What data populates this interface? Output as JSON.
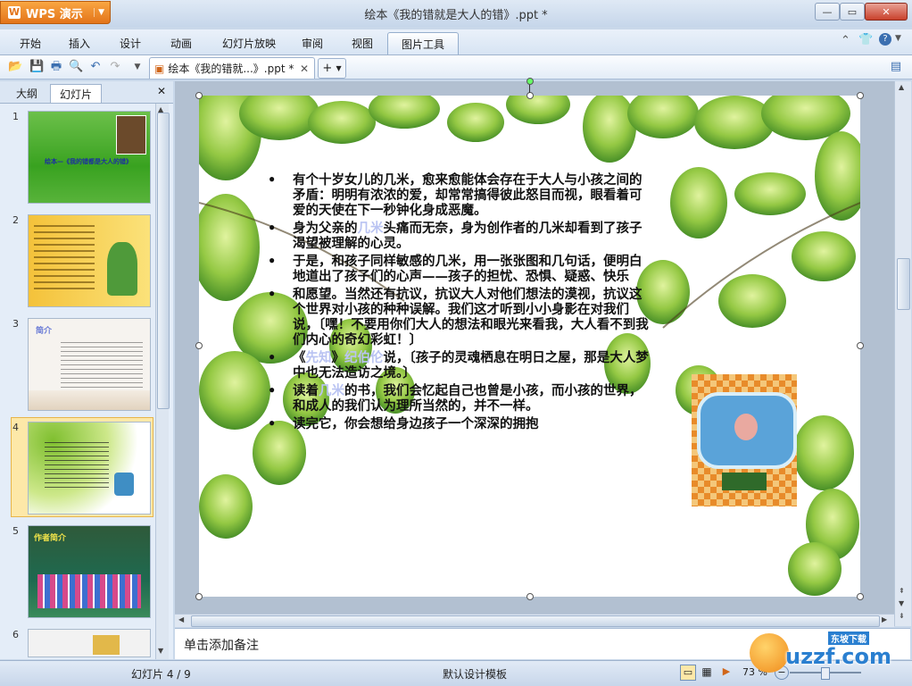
{
  "app": {
    "name": "WPS 演示"
  },
  "window": {
    "title": "绘本《我的错就是大人的错》.ppt *"
  },
  "menu": {
    "tabs": [
      {
        "label": "开始"
      },
      {
        "label": "插入"
      },
      {
        "label": "设计"
      },
      {
        "label": "动画"
      },
      {
        "label": "幻灯片放映"
      },
      {
        "label": "审阅"
      },
      {
        "label": "视图"
      },
      {
        "label": "图片工具"
      }
    ],
    "active": "图片工具"
  },
  "toolbar": {
    "doc_tab": "绘本《我的错就...》.ppt *",
    "new_tab": "+"
  },
  "panel": {
    "tabs": [
      {
        "label": "大纲"
      },
      {
        "label": "幻灯片"
      }
    ],
    "active": "幻灯片",
    "thumbnails": [
      {
        "num": "1",
        "caption": "绘本—《我的错都是大人的错》"
      },
      {
        "num": "2"
      },
      {
        "num": "3",
        "caption": "简介"
      },
      {
        "num": "4"
      },
      {
        "num": "5",
        "caption": "作者简介"
      },
      {
        "num": "6"
      }
    ]
  },
  "slide": {
    "bullets": [
      {
        "pre": "有个十岁女儿的几米，愈来愈能体会存在于大人与小孩之间的矛盾：明明有浓浓的爱，却常常搞得彼此怒目而视，眼看着可爱的天使在下一秒钟化身成恶魔。",
        "hl": "",
        "post": ""
      },
      {
        "pre": "身为父亲的",
        "hl": "几米",
        "post": "头痛而无奈，身为创作者的几米却看到了孩子渴望被理解的心灵。"
      },
      {
        "pre": "于是，和孩子同样敏感的几米，用一张张图和几句话，便明白地道出了孩子们的心声——孩子的担忧、恐惧、疑惑、快乐",
        "hl": "",
        "post": ""
      },
      {
        "pre": "和愿望。当然还有抗议，抗议大人对他们想法的漠视，抗议这个世界对小孩的种种误解。我们这才听到小小身影在对我们说，〔嘿！不要用你们大人的想法和眼光来看我，大人看不到我们内心的奇幻彩虹！〕",
        "hl": "",
        "post": ""
      },
      {
        "pre": "《",
        "hl": "先知",
        "mid": "》",
        "hl2": "纪伯伦",
        "post": "说，〔孩子的灵魂栖息在明日之屋，那是大人梦中也无法造访之境。〕"
      },
      {
        "pre": "读着",
        "hl": "几米",
        "post": "的书，我们会忆起自己也曾是小孩，而小孩的世界，和成人的我们认为理所当然的，并不一样。"
      },
      {
        "pre": "读完它，你会想给身边孩子一个深深的拥抱",
        "hl": "",
        "post": ""
      }
    ]
  },
  "notes": {
    "placeholder": "单击添加备注"
  },
  "status": {
    "slide_indicator": "幻灯片 4 / 9",
    "template": "默认设计模板",
    "zoom": "73 %"
  },
  "watermark": {
    "text": "uzzf.com",
    "sub": "东坡下载"
  },
  "colors": {
    "accent": "#e3741a",
    "chrome": "#c9d8ea",
    "highlight": "#b9c3f2"
  }
}
